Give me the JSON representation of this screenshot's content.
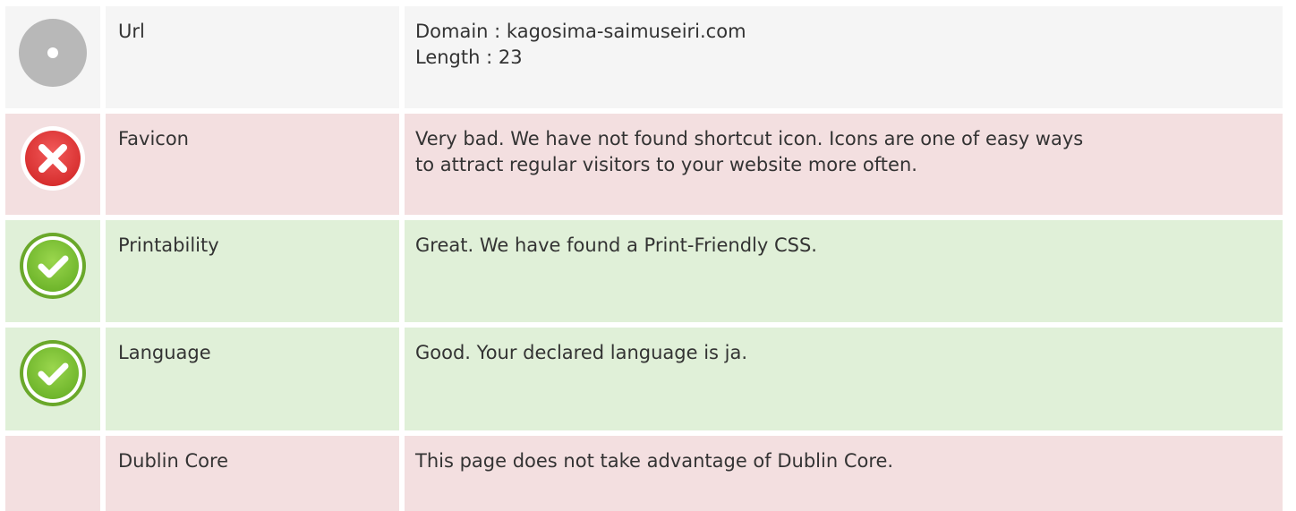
{
  "rows": [
    {
      "status": "neutral",
      "icon": "neutral-circle-icon",
      "name": "Url",
      "lines": [
        "Domain : kagosima-saimuseiri.com",
        "Length : 23"
      ]
    },
    {
      "status": "bad",
      "icon": "error-x-icon",
      "name": "Favicon",
      "lines": [
        "Very bad. We have not found shortcut icon. Icons are one of easy ways",
        "to attract regular visitors to your website more often."
      ]
    },
    {
      "status": "good",
      "icon": "check-icon",
      "name": "Printability",
      "lines": [
        "Great. We have found a Print-Friendly CSS."
      ]
    },
    {
      "status": "good",
      "icon": "check-icon",
      "name": "Language",
      "lines": [
        "Good. Your declared language is ja."
      ]
    },
    {
      "status": "bad",
      "icon": "",
      "name": "Dublin Core",
      "lines": [
        "This page does not take advantage of Dublin Core."
      ]
    }
  ],
  "colors": {
    "neutral_bg": "#f5f5f5",
    "bad_bg": "#f3dfe0",
    "good_bg": "#e0f0d8",
    "error_red": "#e03a3a",
    "success_green": "#7dc334",
    "neutral_gray": "#b8b8b8"
  }
}
